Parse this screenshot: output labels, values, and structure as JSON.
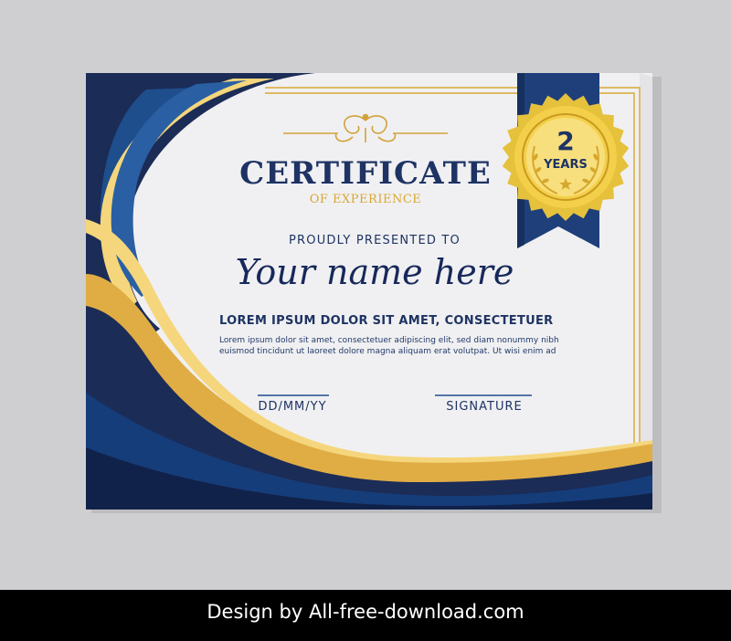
{
  "certificate": {
    "title": "CERTIFICATE",
    "subtitle": "OF EXPERIENCE",
    "presented": "PROUDLY PRESENTED TO",
    "name": "Your name here",
    "heading": "LOREM IPSUM DOLOR SIT AMET, CONSECTETUER",
    "body_line1": "Lorem ipsum dolor sit amet, consectetuer adipiscing elit, sed diam nonummy nibh",
    "body_line2": "euismod tincidunt ut laoreet dolore magna aliquam erat volutpat. Ut wisi enim ad",
    "date_label": "DD/MM/YY",
    "signature_label": "SIGNATURE"
  },
  "badge": {
    "number": "2",
    "label": "YEARS"
  },
  "footer": {
    "text": "Design by All-free-download.com"
  },
  "colors": {
    "navy": "#1e3363",
    "blue": "#1f4e8c",
    "gold": "#e0ad45",
    "paper": "#f0f0f2",
    "background": "#cfcfd1"
  }
}
